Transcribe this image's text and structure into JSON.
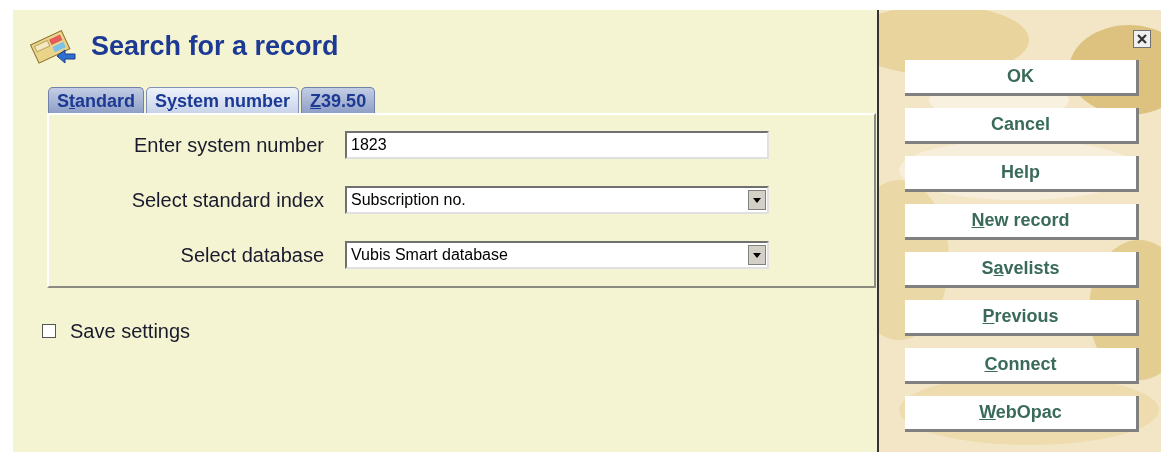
{
  "title": "Search for a record",
  "tabs": [
    {
      "pre": "S",
      "key": "t",
      "post": "andard",
      "selected": false
    },
    {
      "pre": "S",
      "key": "y",
      "post": "stem number",
      "selected": true
    },
    {
      "key": "Z",
      "post": "39.50",
      "selected": false
    }
  ],
  "fields": [
    {
      "kind": "text",
      "label": "Enter system number",
      "value": "1823"
    },
    {
      "kind": "select",
      "label": "Select standard index",
      "value": "Subscription no."
    },
    {
      "kind": "select",
      "label": "Select database",
      "value": "Vubis Smart database"
    }
  ],
  "save_settings": {
    "label": "Save settings",
    "checked": false
  },
  "buttons": [
    {
      "pre": "OK"
    },
    {
      "pre": "Cancel"
    },
    {
      "pre": "Help"
    },
    {
      "key": "N",
      "post": "ew record"
    },
    {
      "pre": "S",
      "key": "a",
      "post": "velists"
    },
    {
      "key": "P",
      "post": "revious"
    },
    {
      "key": "C",
      "post": "onnect"
    },
    {
      "key": "W",
      "post": "ebOpac"
    }
  ]
}
